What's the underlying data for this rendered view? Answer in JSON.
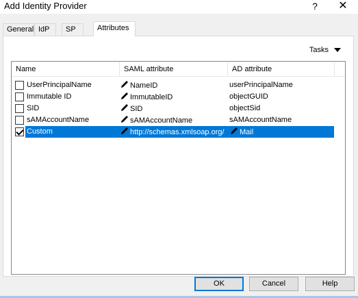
{
  "window": {
    "title": "Add Identity Provider",
    "help_glyph": "?",
    "close_glyph": "✕"
  },
  "tabs": [
    {
      "label": "General"
    },
    {
      "label": "IdP"
    },
    {
      "label": "SP"
    },
    {
      "label": "Attributes"
    }
  ],
  "active_tab": "Attributes",
  "tasks_menu": {
    "label": "Tasks"
  },
  "table": {
    "columns": [
      "Name",
      "SAML attribute",
      "AD attribute"
    ],
    "rows": [
      {
        "checked": false,
        "name": "UserPrincipalName",
        "saml": "NameID",
        "ad": "userPrincipalName",
        "selected": false
      },
      {
        "checked": false,
        "name": "Immutable ID",
        "saml": "ImmutableID",
        "ad": "objectGUID",
        "selected": false
      },
      {
        "checked": false,
        "name": "SID",
        "saml": "SID",
        "ad": "objectSid",
        "selected": false
      },
      {
        "checked": false,
        "name": "sAMAccountName",
        "saml": "sAMAccountName",
        "ad": "sAMAccountName",
        "selected": false
      },
      {
        "checked": true,
        "name": "Custom",
        "saml": "http://schemas.xmlsoap.org/",
        "ad": "Mail",
        "selected": true
      }
    ]
  },
  "buttons": {
    "ok": "OK",
    "cancel": "Cancel",
    "help": "Help"
  },
  "colors": {
    "selection": "#0078d7",
    "dialog_bg": "#f0f0f0",
    "panel_bg": "#ffffff"
  }
}
